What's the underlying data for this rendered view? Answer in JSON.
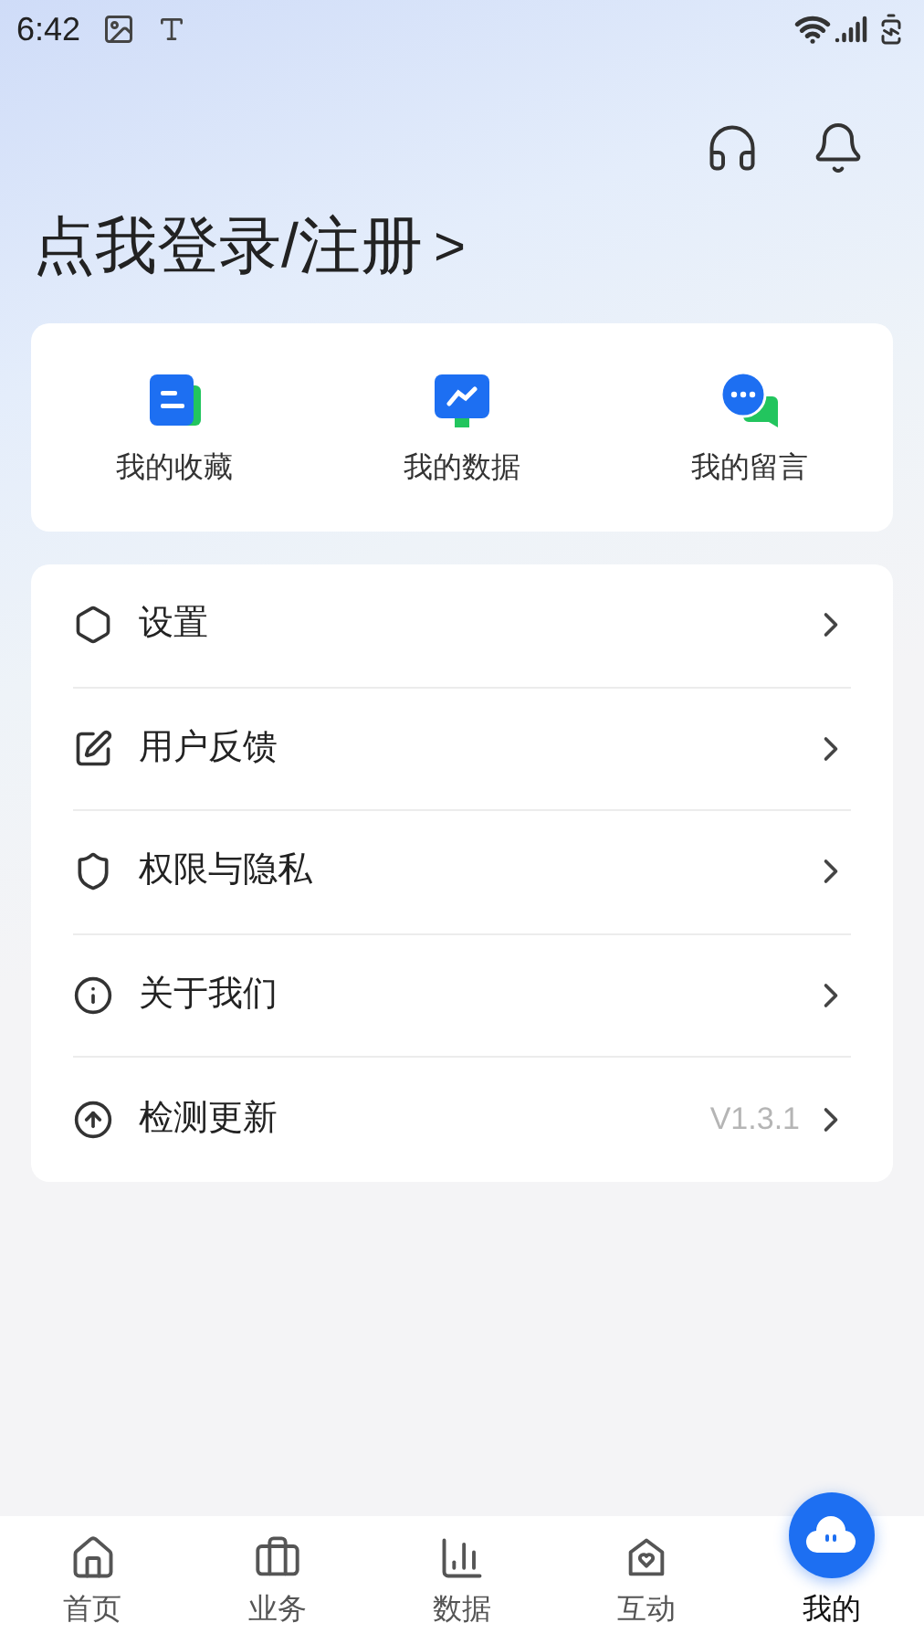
{
  "status_bar": {
    "time": "6:42"
  },
  "login": {
    "label": "点我登录/注册",
    "arrow": ">"
  },
  "quick_actions": [
    {
      "kind": "favorites",
      "label": "我的收藏"
    },
    {
      "kind": "data",
      "label": "我的数据"
    },
    {
      "kind": "messages",
      "label": "我的留言"
    }
  ],
  "menu": [
    {
      "kind": "settings",
      "label": "设置"
    },
    {
      "kind": "feedback",
      "label": "用户反馈"
    },
    {
      "kind": "privacy",
      "label": "权限与隐私"
    },
    {
      "kind": "about",
      "label": "关于我们"
    },
    {
      "kind": "update",
      "label": "检测更新",
      "value": "V1.3.1"
    }
  ],
  "tabs": [
    {
      "kind": "home",
      "label": "首页",
      "selected": false
    },
    {
      "kind": "business",
      "label": "业务",
      "selected": false
    },
    {
      "kind": "data",
      "label": "数据",
      "selected": false
    },
    {
      "kind": "interact",
      "label": "互动",
      "selected": false
    },
    {
      "kind": "mine",
      "label": "我的",
      "selected": true
    }
  ]
}
